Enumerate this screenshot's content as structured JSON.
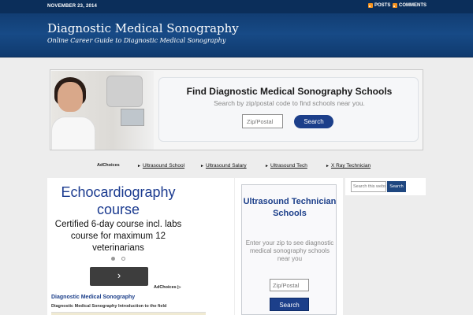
{
  "header": {
    "date": "NOVEMBER 23, 2014",
    "feeds": [
      {
        "label": "POSTS",
        "icon": "rss-icon"
      },
      {
        "label": "COMMENTS",
        "icon": "rss-icon"
      }
    ],
    "site_title": "Diagnostic Medical Sonography",
    "site_description": "Online Career Guide to Diagnostic Medical Sonography",
    "colors": {
      "header_bg": "#174a86",
      "topbar_bg": "#0b2e5a",
      "rss": "#f7931e"
    }
  },
  "banner": {
    "title": "Find Diagnostic Medical Sonography Schools",
    "subtitle": "Search by zip/postal code to find schools near you.",
    "zip_placeholder": "Zip/Postal",
    "search_label": "Search",
    "accent": "#1c3f8a"
  },
  "ad_links": {
    "ad_choices": "AdChoices",
    "links": [
      "Ultrasound School",
      "Ultrasound Salary",
      "Ultrasound Tech",
      "X Ray Technician"
    ]
  },
  "main": {
    "ad_heading": "Echocardiography course",
    "ad_body": "Certified 6-day course incl. labs course for maximum 12 veterinarians",
    "carousel": {
      "active_index": 0,
      "count": 2
    },
    "next_icon": "chevron-right-icon",
    "ad_choices": "AdChoices",
    "post_title": "Diagnostic Medical Sonography",
    "post_subtitle": "Diagnostic Medical Sonography Introduction to the field"
  },
  "middle": {
    "title": "Ultrasound Technician Schools",
    "text": "Enter your zip to see diagnostic medical sonography schools near you",
    "zip_placeholder": "Zip/Postal",
    "search_label": "Search"
  },
  "sidebar": {
    "search_placeholder": "Search this website...",
    "search_label": "Search"
  }
}
